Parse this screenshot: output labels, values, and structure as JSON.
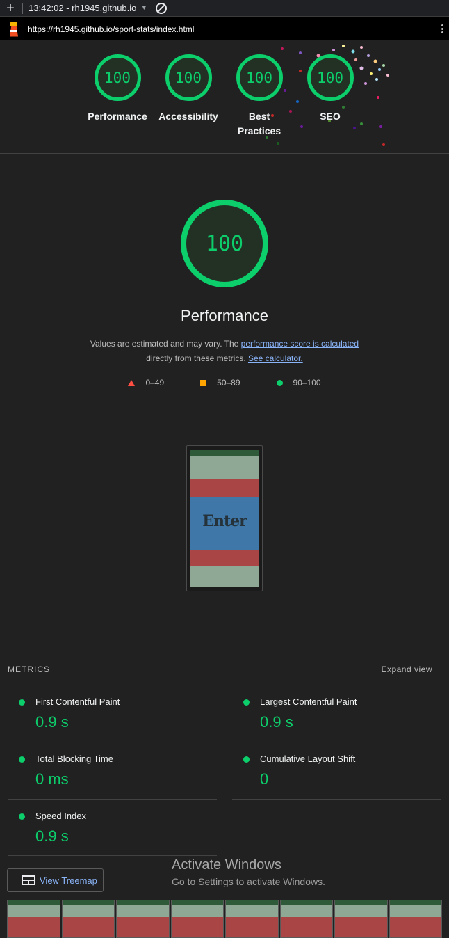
{
  "topbar": {
    "plus": "+",
    "time_host": "13:42:02 - rh1945.github.io",
    "caret": "▼"
  },
  "urlbar": {
    "url": "https://rh1945.github.io/sport-stats/index.html"
  },
  "gauges": [
    {
      "score": "100",
      "label": "Performance"
    },
    {
      "score": "100",
      "label": "Accessibility"
    },
    {
      "score": "100",
      "label": "Best Practices"
    },
    {
      "score": "100",
      "label": "SEO"
    }
  ],
  "category": {
    "score": "100",
    "title": "Performance",
    "desc_prefix": "Values are estimated and may vary. The ",
    "desc_link1": "performance score is calculated",
    "desc_middle": " directly from these metrics. ",
    "desc_link2": "See calculator."
  },
  "legend": {
    "fail": "0–49",
    "average": "50–89",
    "pass": "90–100"
  },
  "screenshot": {
    "caption": "Enter"
  },
  "metrics": {
    "header": "METRICS",
    "expand": "Expand view",
    "items": [
      {
        "name": "First Contentful Paint",
        "value": "0.9 s"
      },
      {
        "name": "Largest Contentful Paint",
        "value": "0.9 s"
      },
      {
        "name": "Total Blocking Time",
        "value": "0 ms"
      },
      {
        "name": "Cumulative Layout Shift",
        "value": "0"
      },
      {
        "name": "Speed Index",
        "value": "0.9 s"
      }
    ]
  },
  "treemap": {
    "label": "View Treemap"
  },
  "watermark": {
    "line1": "Activate Windows",
    "line2": "Go to Settings to activate Windows."
  },
  "colors": {
    "pass": "#0cce6b",
    "average": "#ffa400",
    "fail": "#ff4e42",
    "link": "#8ab4f8"
  }
}
